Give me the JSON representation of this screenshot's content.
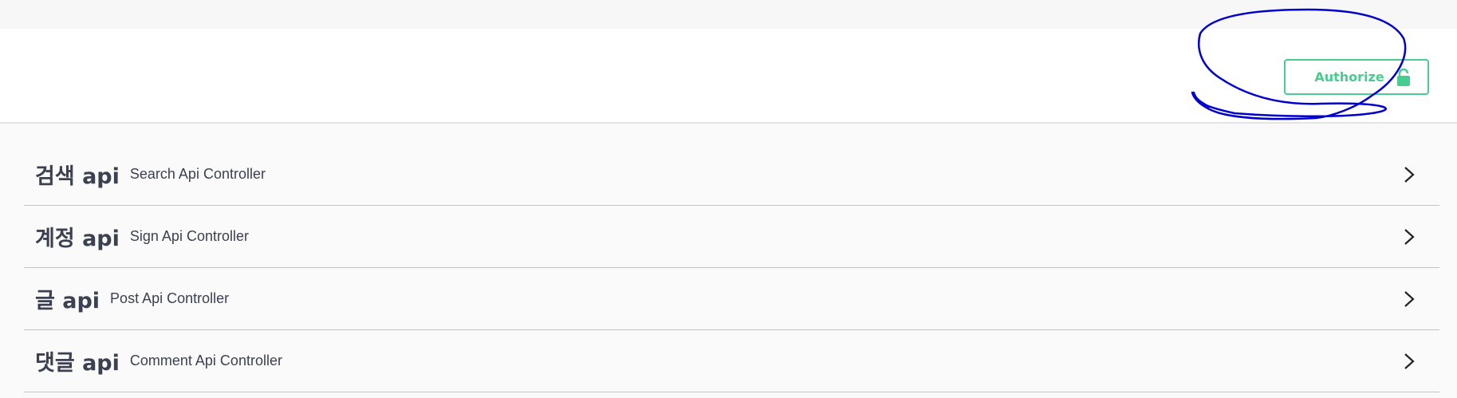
{
  "scheme": {
    "authorize_label": "Authorize",
    "accent_color": "#49cc90"
  },
  "annotation": {
    "color": "#0000cc",
    "shape": "hand-drawn circle around Authorize button"
  },
  "tags": [
    {
      "name": "검색 api",
      "description": "Search Api Controller",
      "icon": "chevron-right-icon"
    },
    {
      "name": "계정 api",
      "description": "Sign Api Controller",
      "icon": "chevron-right-icon"
    },
    {
      "name": "글 api",
      "description": "Post Api Controller",
      "icon": "chevron-right-icon"
    },
    {
      "name": "댓글 api",
      "description": "Comment Api Controller",
      "icon": "chevron-right-icon"
    }
  ]
}
